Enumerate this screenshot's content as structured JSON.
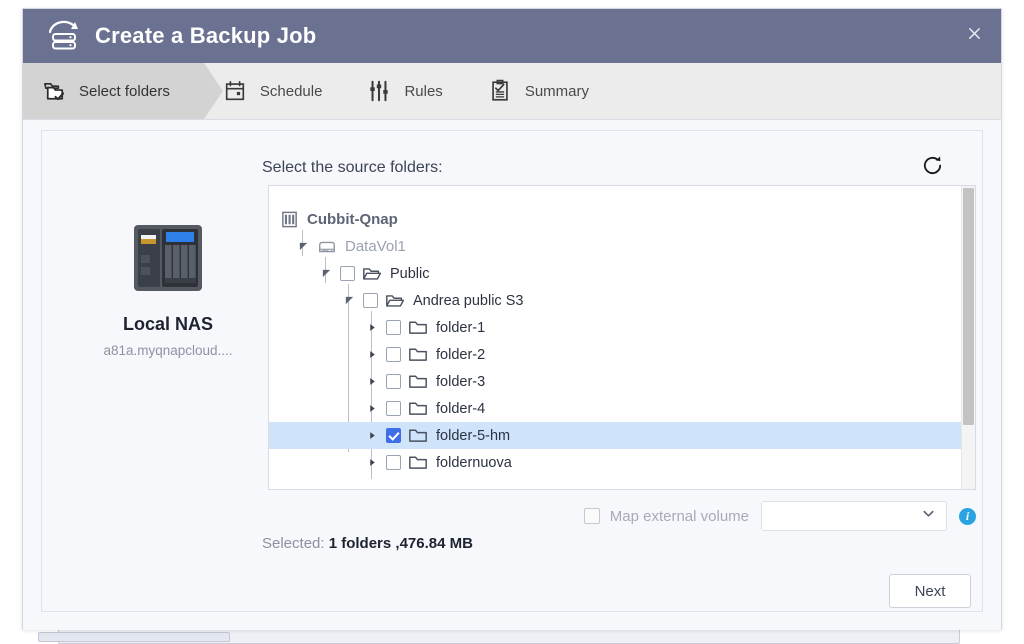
{
  "window": {
    "title": "Create a Backup Job",
    "title_icon": "backup-restore-icon",
    "close_label": "×",
    "header_color": "#6b7191"
  },
  "steps": [
    {
      "label": "Select folders",
      "icon": "select-folders-icon",
      "active": true
    },
    {
      "label": "Schedule",
      "icon": "calendar-icon",
      "active": false
    },
    {
      "label": "Rules",
      "icon": "sliders-icon",
      "active": false
    },
    {
      "label": "Summary",
      "icon": "clipboard-check-icon",
      "active": false
    }
  ],
  "source_device": {
    "icon": "nas-device-icon",
    "name": "Local NAS",
    "host": "a81a.myqnapcloud...."
  },
  "source_panel": {
    "label": "Select the source folders:",
    "refresh_icon": "refresh-icon"
  },
  "tree": [
    {
      "label": "Cubbit-Qnap",
      "indent": 0,
      "twist": "none",
      "icon": "nas-small-icon",
      "checkbox": "none",
      "style": "root",
      "selected": false
    },
    {
      "label": "DataVol1",
      "indent": 1,
      "twist": "expanded",
      "icon": "volume-icon",
      "checkbox": "none",
      "style": "vol",
      "selected": false
    },
    {
      "label": "Public",
      "indent": 2,
      "twist": "expanded",
      "icon": "folder-open-icon",
      "checkbox": "unchecked",
      "style": "normal",
      "selected": false
    },
    {
      "label": "Andrea public S3",
      "indent": 3,
      "twist": "expanded",
      "icon": "folder-open-icon",
      "checkbox": "unchecked",
      "style": "normal",
      "selected": false
    },
    {
      "label": "folder-1",
      "indent": 4,
      "twist": "collapsed",
      "icon": "folder-closed-icon",
      "checkbox": "unchecked",
      "style": "normal",
      "selected": false
    },
    {
      "label": "folder-2",
      "indent": 4,
      "twist": "collapsed",
      "icon": "folder-closed-icon",
      "checkbox": "unchecked",
      "style": "normal",
      "selected": false
    },
    {
      "label": "folder-3",
      "indent": 4,
      "twist": "collapsed",
      "icon": "folder-closed-icon",
      "checkbox": "unchecked",
      "style": "normal",
      "selected": false
    },
    {
      "label": "folder-4",
      "indent": 4,
      "twist": "collapsed",
      "icon": "folder-closed-icon",
      "checkbox": "unchecked",
      "style": "normal",
      "selected": false
    },
    {
      "label": "folder-5-hm",
      "indent": 4,
      "twist": "collapsed",
      "icon": "folder-closed-icon",
      "checkbox": "checked",
      "style": "normal",
      "selected": true
    },
    {
      "label": "foldernuova",
      "indent": 4,
      "twist": "collapsed",
      "icon": "folder-closed-icon",
      "checkbox": "unchecked",
      "style": "normal",
      "selected": false
    }
  ],
  "map_volume": {
    "label": "Map external volume",
    "checked": false,
    "enabled": false,
    "select_value": "",
    "info_icon": "info-icon",
    "info_glyph": "i"
  },
  "selection_status": {
    "key": "Selected:",
    "value": "1 folders ,476.84 MB"
  },
  "footer": {
    "next_label": "Next"
  },
  "colors": {
    "header": "#6b7191",
    "accent_checkbox": "#3f6fe8",
    "row_selected": "#cfe3fb",
    "info_blue": "#2aa3e0",
    "panel_bg": "#f6f8fc"
  }
}
